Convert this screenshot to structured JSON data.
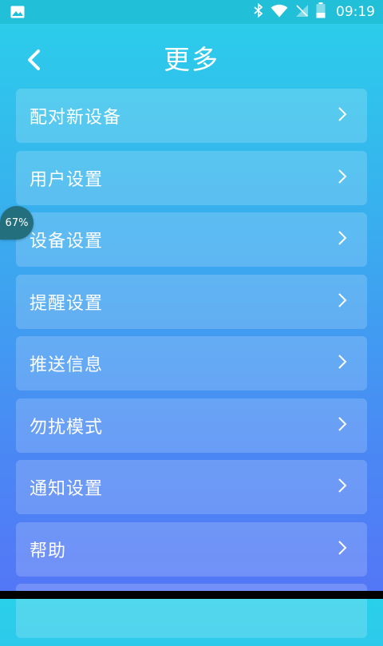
{
  "status_bar": {
    "time": "09:19",
    "icons": [
      "image-icon",
      "bluetooth-icon",
      "wifi-icon",
      "no-sim-icon",
      "battery-icon"
    ]
  },
  "header": {
    "title": "更多",
    "back_icon": "back-arrow-icon"
  },
  "menu": {
    "items": [
      {
        "label": "配对新设备"
      },
      {
        "label": "用户设置"
      },
      {
        "label": "设备设置"
      },
      {
        "label": "提醒设置"
      },
      {
        "label": "推送信息"
      },
      {
        "label": "勿扰模式"
      },
      {
        "label": "通知设置"
      },
      {
        "label": "帮助"
      },
      {
        "label": ""
      }
    ]
  },
  "floating_badge": {
    "text": "67%"
  },
  "colors": {
    "gradient_top": "#2ad0ea",
    "gradient_bottom": "#5476f7",
    "badge": "#236f7d"
  }
}
